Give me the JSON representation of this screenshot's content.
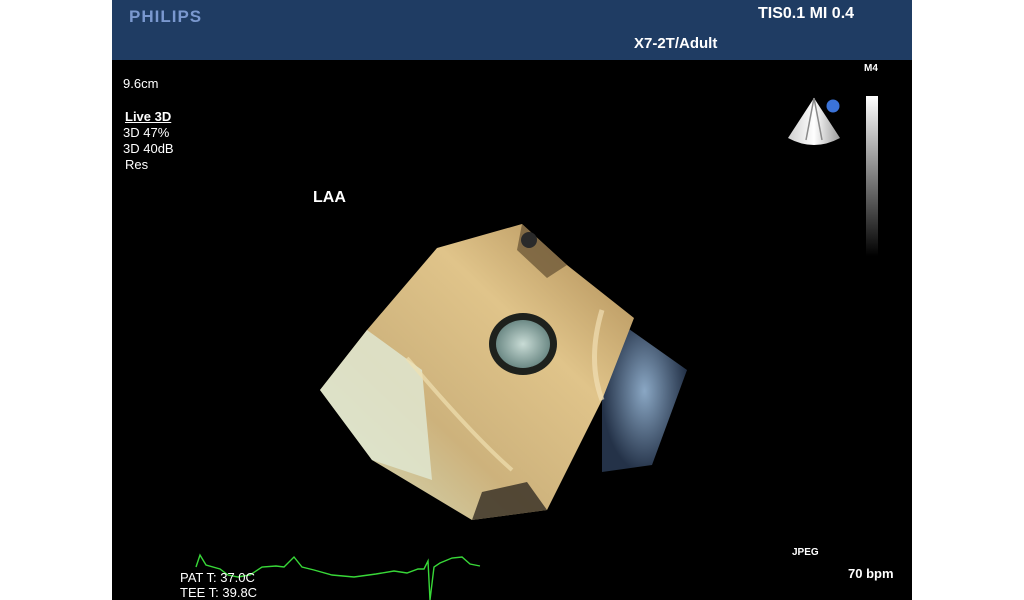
{
  "header": {
    "logo": "PHILIPS",
    "tis_mi": "TIS0.1   MI 0.4",
    "probe": "X7-2T/Adult"
  },
  "overlay": {
    "depth": "9.6cm",
    "mode": "Live 3D",
    "gain": "3D 47%",
    "compression": "3D 40dB",
    "res": "Res",
    "annotation": "LAA",
    "map": "M4",
    "format": "JPEG",
    "heart_rate": "70 bpm",
    "pat_temp": "PAT T: 37.0C",
    "tee_temp": "TEE T: 39.8C"
  },
  "icons": {
    "orientation": "orientation-cone-icon",
    "grayscale": "grayscale-bar-icon"
  },
  "colors": {
    "header_bg": "#1f3c63",
    "logo": "#7a98cf",
    "ecg_trace": "#38d838",
    "orientation_marker": "#3b73d8"
  }
}
